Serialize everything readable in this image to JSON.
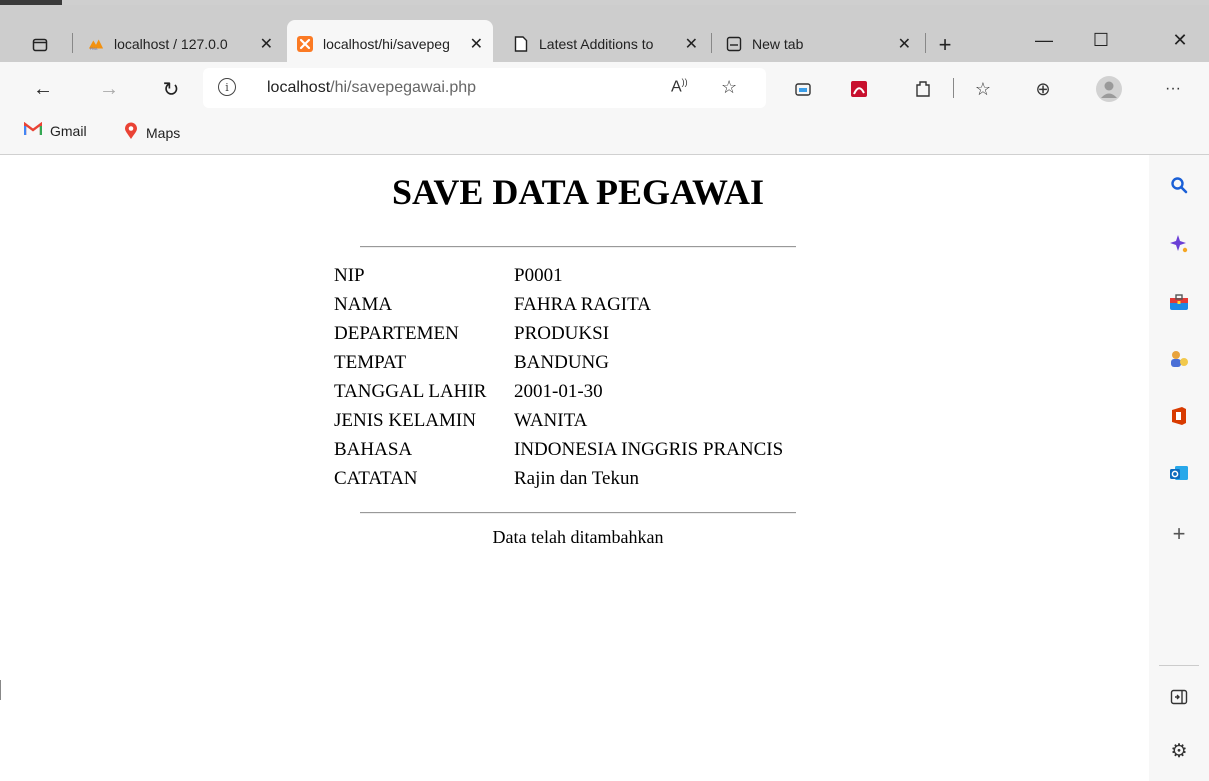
{
  "tabs": [
    {
      "title": "localhost / 127.0.0",
      "icon": "phpmyadmin-icon",
      "active": false
    },
    {
      "title": "localhost/hi/savepeg",
      "icon": "xampp-icon",
      "active": true
    },
    {
      "title": "Latest Additions to",
      "icon": "page-icon",
      "active": false
    },
    {
      "title": "New tab",
      "icon": "new-tab-icon",
      "active": false
    }
  ],
  "window_controls": {
    "minimize": "—",
    "maximize": "☐",
    "close": "✕"
  },
  "nav": {
    "back": "←",
    "forward": "→",
    "refresh": "↻"
  },
  "address": {
    "host": "localhost",
    "path": "/hi/savepegawai.php"
  },
  "bookmarks": [
    {
      "label": "Gmail",
      "icon": "gmail-icon"
    },
    {
      "label": "Maps",
      "icon": "maps-icon"
    }
  ],
  "page": {
    "title": "SAVE DATA PEGAWAI",
    "fields": [
      {
        "label": "NIP",
        "value": "P0001"
      },
      {
        "label": "NAMA",
        "value": "FAHRA RAGITA"
      },
      {
        "label": "DEPARTEMEN",
        "value": "PRODUKSI"
      },
      {
        "label": "TEMPAT",
        "value": "BANDUNG"
      },
      {
        "label": "TANGGAL LAHIR",
        "value": "2001-01-30"
      },
      {
        "label": "JENIS KELAMIN",
        "value": "WANITA"
      },
      {
        "label": "BAHASA",
        "value": "INDONESIA INGGRIS PRANCIS"
      },
      {
        "label": "CATATAN",
        "value": "Rajin dan Tekun"
      }
    ],
    "message": "Data telah ditambahkan"
  },
  "colors": {
    "tabbar": "#cdcdcd",
    "toolbar": "#f7f7f7",
    "sidebar_search": "#1a5fd6",
    "sidebar_copilot": "#6b3fd6",
    "office_red": "#d83b01",
    "outlook_blue": "#0f6cbd"
  }
}
